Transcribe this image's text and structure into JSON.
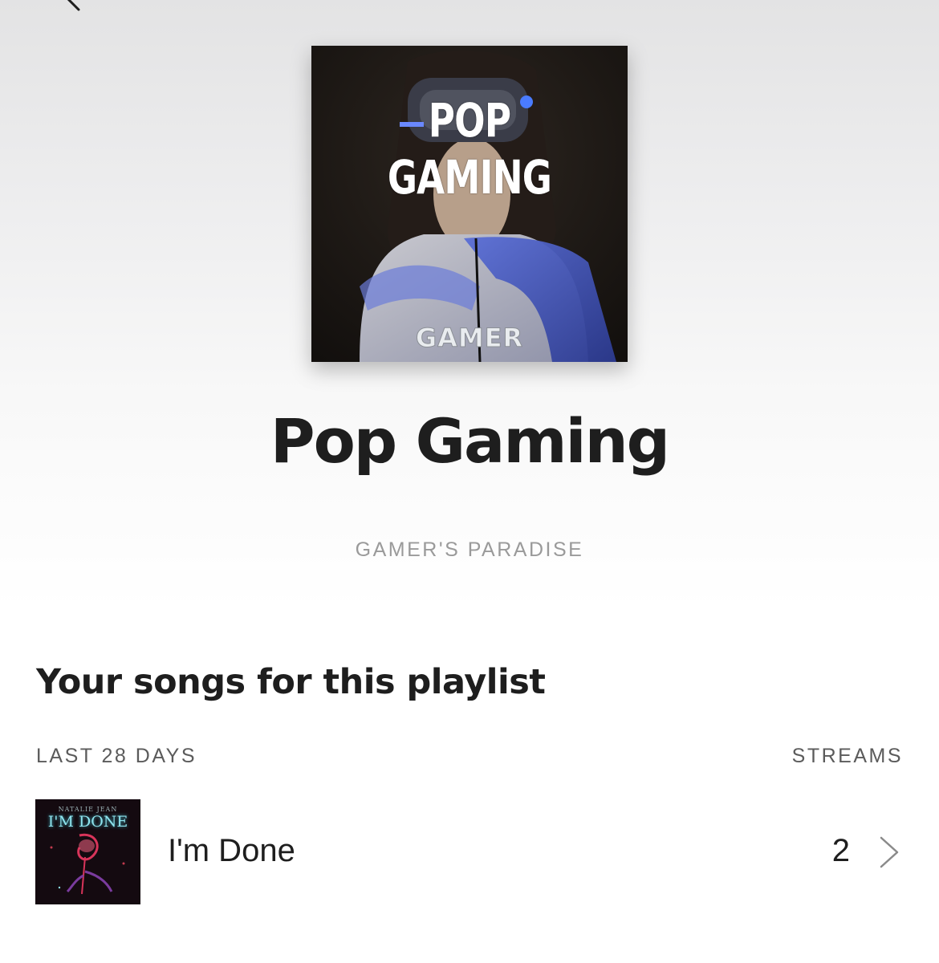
{
  "header": {
    "back_icon": "chevron-left-icon"
  },
  "playlist": {
    "cover_title_line1": "POP",
    "cover_title_line2": "GAMING",
    "cover_brand": "GAMER",
    "title": "Pop Gaming",
    "owner": "GAMER'S PARADISE"
  },
  "section": {
    "heading": "Your songs for this playlist",
    "period_label": "LAST 28 DAYS",
    "streams_label": "STREAMS"
  },
  "songs": [
    {
      "artwork_artist": "NATALIE JEAN",
      "artwork_title": "I'M DONE",
      "name": "I'm Done",
      "streams": "2",
      "chevron_icon": "chevron-right-icon"
    }
  ],
  "colors": {
    "header_gradient_top": "#e3e3e4",
    "text_primary": "#1e1e1e",
    "text_secondary": "#9a9a9a",
    "label_gray": "#5b5b5b"
  }
}
